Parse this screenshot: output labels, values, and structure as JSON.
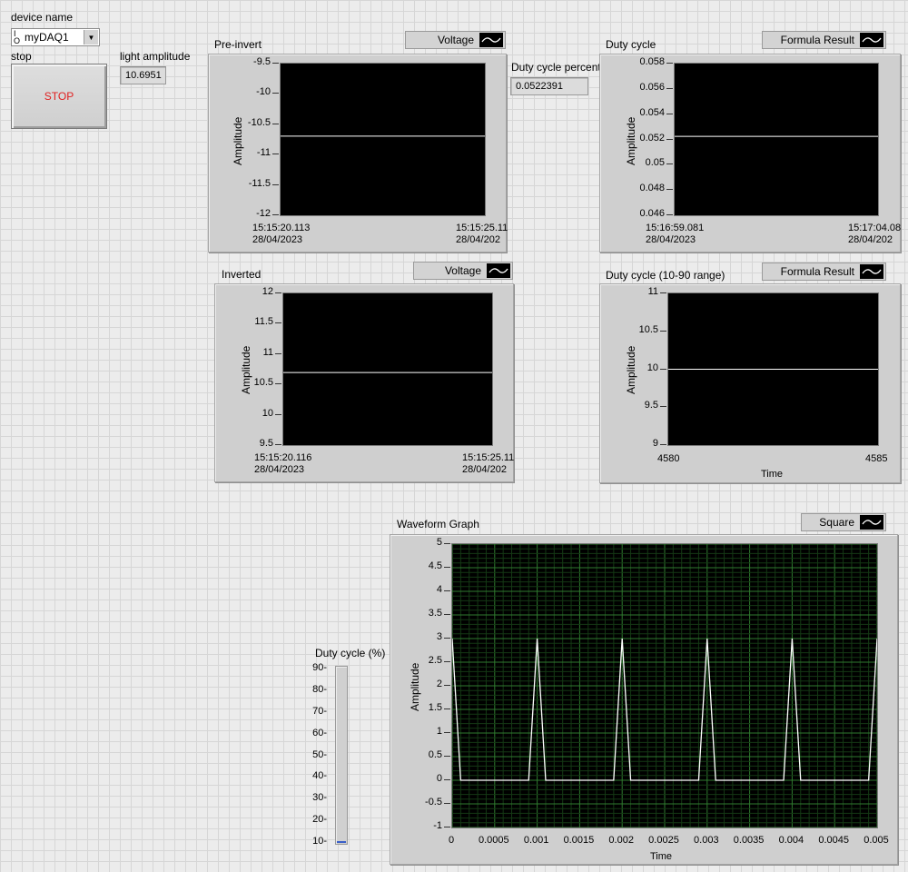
{
  "device": {
    "label": "device name",
    "io_symbol": "I/O",
    "value": "myDAQ1"
  },
  "stop": {
    "label": "stop",
    "button_text": "STOP"
  },
  "light_amplitude": {
    "label": "light amplitude",
    "value": "10.6951"
  },
  "duty_cycle_percentage": {
    "label": "Duty cycle percentage",
    "value": "0.0522391"
  },
  "colors": {
    "plot_bg": "#000000",
    "trace": "#ffffff",
    "grid": "#2f7a2f",
    "stop_text": "#e02020",
    "slide_fill": "#3a5fc8"
  },
  "charts": {
    "pre_invert": {
      "title": "Pre-invert",
      "legend": "Voltage",
      "ylabel": "Amplitude",
      "yticks": [
        "-9.5",
        "-10",
        "-10.5",
        "-11",
        "-11.5",
        "-12"
      ],
      "x_start": [
        "15:15:20.113",
        "28/04/2023"
      ],
      "x_end": [
        "15:15:25.11",
        "28/04/202"
      ]
    },
    "inverted": {
      "title": "Inverted",
      "legend": "Voltage",
      "ylabel": "Amplitude",
      "yticks": [
        "12",
        "11.5",
        "11",
        "10.5",
        "10",
        "9.5"
      ],
      "x_start": [
        "15:15:20.116",
        "28/04/2023"
      ],
      "x_end": [
        "15:15:25.11",
        "28/04/202"
      ]
    },
    "duty_cycle": {
      "title": "Duty cycle",
      "legend": "Formula Result",
      "ylabel": "Amplitude",
      "yticks": [
        "0.058",
        "0.056",
        "0.054",
        "0.052",
        "0.05",
        "0.048",
        "0.046"
      ],
      "x_start": [
        "15:16:59.081",
        "28/04/2023"
      ],
      "x_end": [
        "15:17:04.08",
        "28/04/202"
      ]
    },
    "duty_cycle_range": {
      "title": "Duty cycle (10-90 range)",
      "legend": "Formula Result",
      "ylabel": "Amplitude",
      "yticks": [
        "11",
        "10.5",
        "10",
        "9.5",
        "9"
      ],
      "xticks": [
        "4580",
        "4585"
      ],
      "xlabel": "Time"
    },
    "waveform": {
      "title": "Waveform Graph",
      "legend": "Square",
      "ylabel": "Amplitude",
      "xlabel": "Time",
      "yticks": [
        "5",
        "4.5",
        "4",
        "3.5",
        "3",
        "2.5",
        "2",
        "1.5",
        "1",
        "0.5",
        "0",
        "-0.5",
        "-1"
      ],
      "xticks": [
        "0",
        "0.0005",
        "0.001",
        "0.0015",
        "0.002",
        "0.0025",
        "0.003",
        "0.0035",
        "0.004",
        "0.0045",
        "0.005"
      ]
    }
  },
  "chart_data": [
    {
      "type": "line",
      "title": "Pre-invert",
      "ylabel": "Amplitude",
      "ylim": [
        -12,
        -9.5
      ],
      "x": [
        0,
        5
      ],
      "values": [
        -10.6951,
        -10.6951
      ]
    },
    {
      "type": "line",
      "title": "Inverted",
      "ylabel": "Amplitude",
      "ylim": [
        9.5,
        12
      ],
      "x": [
        0,
        5
      ],
      "values": [
        10.6951,
        10.6951
      ]
    },
    {
      "type": "line",
      "title": "Duty cycle",
      "ylabel": "Amplitude",
      "ylim": [
        0.046,
        0.058
      ],
      "x": [
        0,
        5
      ],
      "values": [
        0.0522391,
        0.0522391
      ]
    },
    {
      "type": "line",
      "title": "Duty cycle (10-90 range)",
      "ylabel": "Amplitude",
      "xlabel": "Time",
      "ylim": [
        9,
        11
      ],
      "xlim": [
        4580,
        4585
      ],
      "x": [
        4580,
        4585
      ],
      "values": [
        10,
        10
      ]
    },
    {
      "type": "line",
      "title": "Waveform Graph",
      "ylabel": "Amplitude",
      "xlabel": "Time",
      "ylim": [
        -1,
        5
      ],
      "xlim": [
        0,
        0.005
      ],
      "grid": true,
      "series": [
        {
          "name": "Square",
          "x": [
            0,
            0.0001,
            0.0009,
            0.001,
            0.0011,
            0.0019,
            0.002,
            0.0021,
            0.0029,
            0.003,
            0.0031,
            0.0039,
            0.004,
            0.0041,
            0.0049,
            0.005
          ],
          "values": [
            3,
            0,
            0,
            3,
            0,
            0,
            3,
            0,
            0,
            3,
            0,
            0,
            3,
            0,
            0,
            3
          ]
        }
      ]
    }
  ],
  "slide": {
    "label": "Duty cycle (%)",
    "ticks": [
      "90",
      "80",
      "70",
      "60",
      "50",
      "40",
      "30",
      "20",
      "10"
    ],
    "min": 10,
    "max": 90,
    "value": 10
  }
}
